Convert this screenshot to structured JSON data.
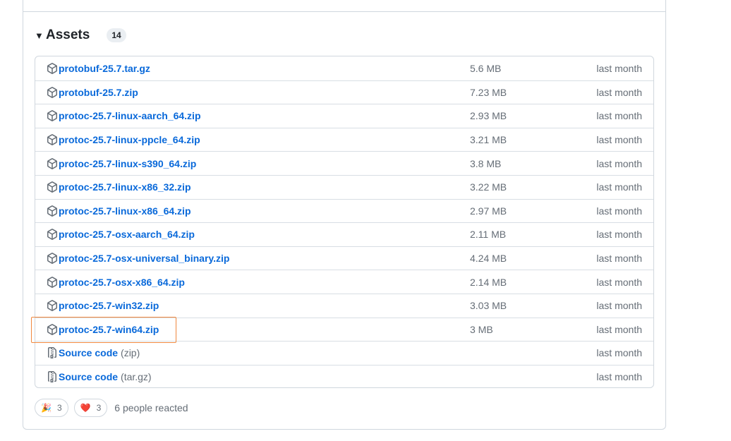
{
  "assets": {
    "title": "Assets",
    "count": "14",
    "items": [
      {
        "name": "protobuf-25.7.tar.gz",
        "suffix": "",
        "size": "5.6 MB",
        "date": "last month",
        "icon": "package-icon"
      },
      {
        "name": "protobuf-25.7.zip",
        "suffix": "",
        "size": "7.23 MB",
        "date": "last month",
        "icon": "package-icon"
      },
      {
        "name": "protoc-25.7-linux-aarch_64.zip",
        "suffix": "",
        "size": "2.93 MB",
        "date": "last month",
        "icon": "package-icon"
      },
      {
        "name": "protoc-25.7-linux-ppcle_64.zip",
        "suffix": "",
        "size": "3.21 MB",
        "date": "last month",
        "icon": "package-icon"
      },
      {
        "name": "protoc-25.7-linux-s390_64.zip",
        "suffix": "",
        "size": "3.8 MB",
        "date": "last month",
        "icon": "package-icon"
      },
      {
        "name": "protoc-25.7-linux-x86_32.zip",
        "suffix": "",
        "size": "3.22 MB",
        "date": "last month",
        "icon": "package-icon"
      },
      {
        "name": "protoc-25.7-linux-x86_64.zip",
        "suffix": "",
        "size": "2.97 MB",
        "date": "last month",
        "icon": "package-icon"
      },
      {
        "name": "protoc-25.7-osx-aarch_64.zip",
        "suffix": "",
        "size": "2.11 MB",
        "date": "last month",
        "icon": "package-icon"
      },
      {
        "name": "protoc-25.7-osx-universal_binary.zip",
        "suffix": "",
        "size": "4.24 MB",
        "date": "last month",
        "icon": "package-icon"
      },
      {
        "name": "protoc-25.7-osx-x86_64.zip",
        "suffix": "",
        "size": "2.14 MB",
        "date": "last month",
        "icon": "package-icon"
      },
      {
        "name": "protoc-25.7-win32.zip",
        "suffix": "",
        "size": "3.03 MB",
        "date": "last month",
        "icon": "package-icon"
      },
      {
        "name": "protoc-25.7-win64.zip",
        "suffix": "",
        "size": "3 MB",
        "date": "last month",
        "icon": "package-icon"
      },
      {
        "name": "Source code",
        "suffix": "(zip)",
        "size": "",
        "date": "last month",
        "icon": "file-zip-icon"
      },
      {
        "name": "Source code",
        "suffix": "(tar.gz)",
        "size": "",
        "date": "last month",
        "icon": "file-zip-icon"
      }
    ]
  },
  "reactions": {
    "items": [
      {
        "emoji": "🎉",
        "count": "3",
        "icon": "tada-emoji-icon"
      },
      {
        "emoji": "❤️",
        "count": "3",
        "icon": "heart-emoji-icon"
      }
    ],
    "summary": "6 people reacted"
  },
  "colors": {
    "link": "#0969da",
    "muted": "#656d76",
    "border": "#d0d7de",
    "highlight": "#f0883e"
  }
}
